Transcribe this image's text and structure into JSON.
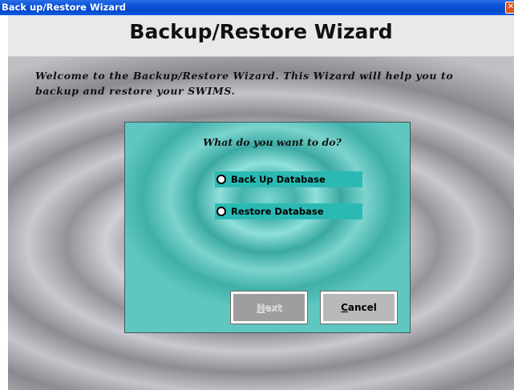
{
  "window": {
    "title": "Back up/Restore Wizard",
    "close_glyph": "✕"
  },
  "header": {
    "title": "Backup/Restore Wizard"
  },
  "welcome_text": "Welcome to the Backup/Restore Wizard. This Wizard will help you to backup and restore your SWIMS.",
  "panel": {
    "question": "What do you want to do?",
    "options": [
      {
        "label": "Back Up Database",
        "selected": false
      },
      {
        "label": "Restore Database",
        "selected": false
      }
    ]
  },
  "buttons": {
    "next": {
      "label_mnemonic": "N",
      "label_rest": "ext",
      "enabled": false
    },
    "cancel": {
      "label_mnemonic": "C",
      "label_rest": "ancel",
      "enabled": true
    }
  },
  "colors": {
    "titlebar": "#0648c6",
    "panel_teal": "#44b3ac",
    "option_band": "#2bbab3",
    "close_button": "#d9541a"
  }
}
